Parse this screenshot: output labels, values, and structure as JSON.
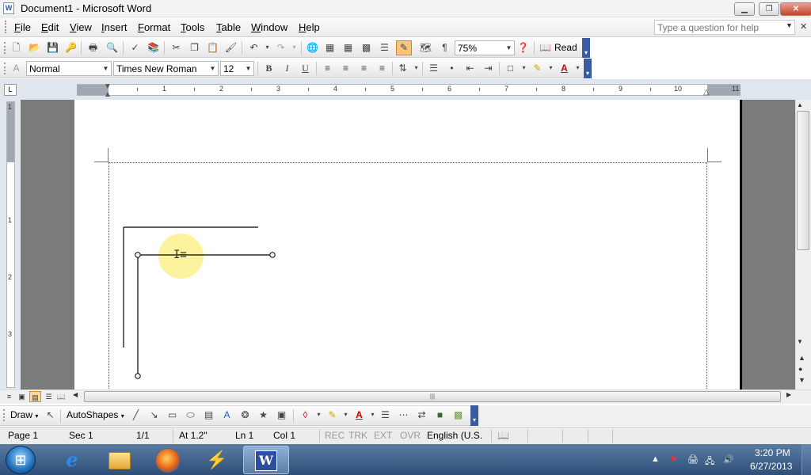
{
  "window": {
    "title_icon": "W",
    "title": "Document1 - Microsoft Word",
    "minimize_glyph": "▁",
    "restore_glyph": "❐",
    "close_glyph": "✕"
  },
  "menu": {
    "items": [
      "File",
      "Edit",
      "View",
      "Insert",
      "Format",
      "Tools",
      "Table",
      "Window",
      "Help"
    ],
    "help_placeholder": "Type a question for help",
    "help_arrow": "▼",
    "doc_close": "✕"
  },
  "standard_toolbar": {
    "zoom": "75%",
    "read_label": "Read",
    "pilcrow": "¶"
  },
  "formatting_toolbar": {
    "style": "Normal",
    "font": "Times New Roman",
    "size": "12",
    "bold": "B",
    "italic": "I",
    "underline": "U",
    "font_color_glyph": "A"
  },
  "ruler": {
    "tab_glyph": "L",
    "h_numbers": [
      "1",
      "2",
      "3",
      "4",
      "5",
      "6",
      "7",
      "8",
      "9",
      "10",
      "11"
    ],
    "v_numbers": [
      "1",
      "1",
      "2",
      "3"
    ]
  },
  "draw_toolbar": {
    "draw_label": "Draw",
    "autoshapes_label": "AutoShapes"
  },
  "status": {
    "page": "Page  1",
    "section": "Sec  1",
    "page_of": "1/1",
    "at": "At  1.2\"",
    "line": "Ln  1",
    "col": "Col  1",
    "rec": "REC",
    "trk": "TRK",
    "ext": "EXT",
    "ovr": "OVR",
    "language": "English (U.S."
  },
  "taskbar": {
    "start_glyph": "⊞",
    "word_glyph": "W",
    "app_glyph": "⚡",
    "time": "3:20 PM",
    "date": "6/27/2013"
  },
  "colors": {
    "highlight": "#fdf08c",
    "titlebar": "#f3f3f3",
    "taskbar": "#2c4e78",
    "doc_background": "#7b7b7b"
  }
}
